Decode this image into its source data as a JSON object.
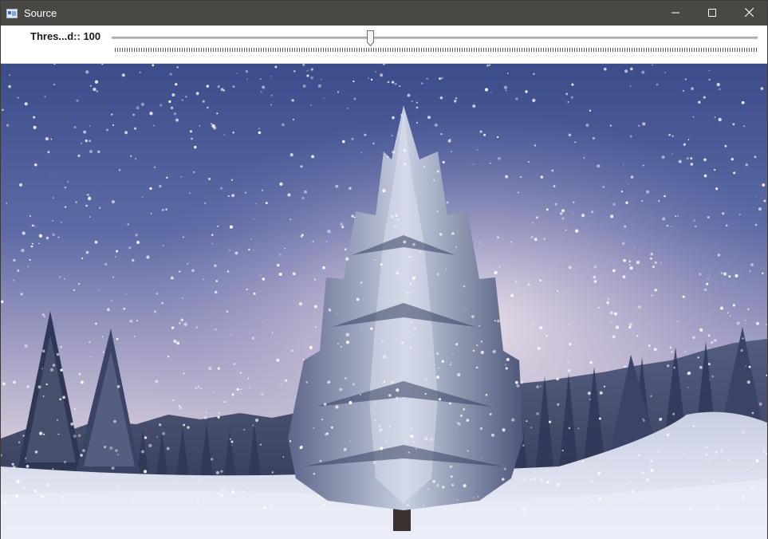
{
  "window": {
    "title": "Source",
    "icon": "app-window-icon",
    "controls": {
      "minimize": "minimize-icon",
      "maximize": "maximize-icon",
      "close": "close-icon"
    }
  },
  "trackbar": {
    "label": "Thres...d:: 100",
    "value": 100,
    "position_fraction": 0.4
  },
  "image": {
    "description_icon": "winter-tree-photo",
    "colors": {
      "sky_top": "#3c4f8c",
      "sky_glow": "#d9cfe0",
      "snow": "#eef1f8",
      "tree_dark": "#2b3550"
    }
  }
}
